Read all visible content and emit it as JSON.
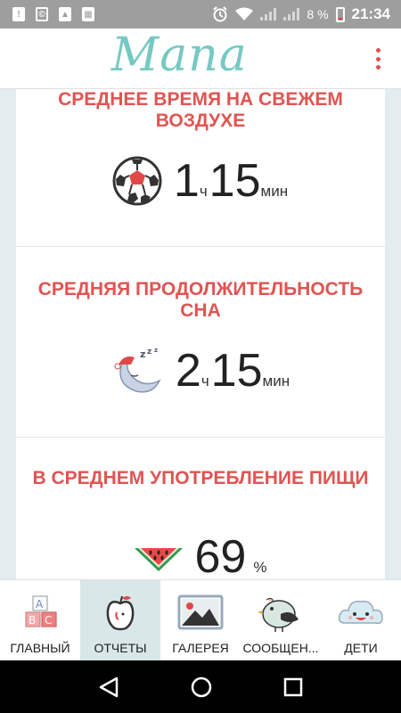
{
  "status_bar": {
    "battery": "8 %",
    "time": "21:34"
  },
  "app": {
    "title": "Mana"
  },
  "stats": [
    {
      "title": "СРЕДНЕЕ ВРЕМЯ НА СВЕЖЕМ ВОЗДУХЕ",
      "value1": "1",
      "unit1": "ч",
      "value2": "15",
      "unit2": "мин",
      "icon": "soccer-ball-icon"
    },
    {
      "title": "СРЕДНЯЯ ПРОДОЛЖИТЕЛЬНОСТЬ СНА",
      "value1": "2",
      "unit1": "ч",
      "value2": "15",
      "unit2": "мин",
      "icon": "sleeping-moon-icon"
    },
    {
      "title": "В СРЕДНЕМ УПОТРЕБЛЕНИЕ ПИЩИ",
      "value": "69",
      "unit": "%",
      "icon": "watermelon-icon"
    }
  ],
  "bottom_nav": [
    {
      "label": "ГЛАВНЫЙ",
      "icon": "abc-blocks-icon",
      "active": false
    },
    {
      "label": "ОТЧЕТЫ",
      "icon": "apple-icon",
      "active": true
    },
    {
      "label": "ГАЛЕРЕЯ",
      "icon": "picture-icon",
      "active": false
    },
    {
      "label": "СООБЩЕН...",
      "icon": "bird-icon",
      "active": false
    },
    {
      "label": "ДЕТИ",
      "icon": "cloud-face-icon",
      "active": false
    }
  ],
  "colors": {
    "accent": "#e05452",
    "logo": "#76c9c3",
    "active_tab": "#d9e7e8",
    "background": "#e3edef"
  }
}
